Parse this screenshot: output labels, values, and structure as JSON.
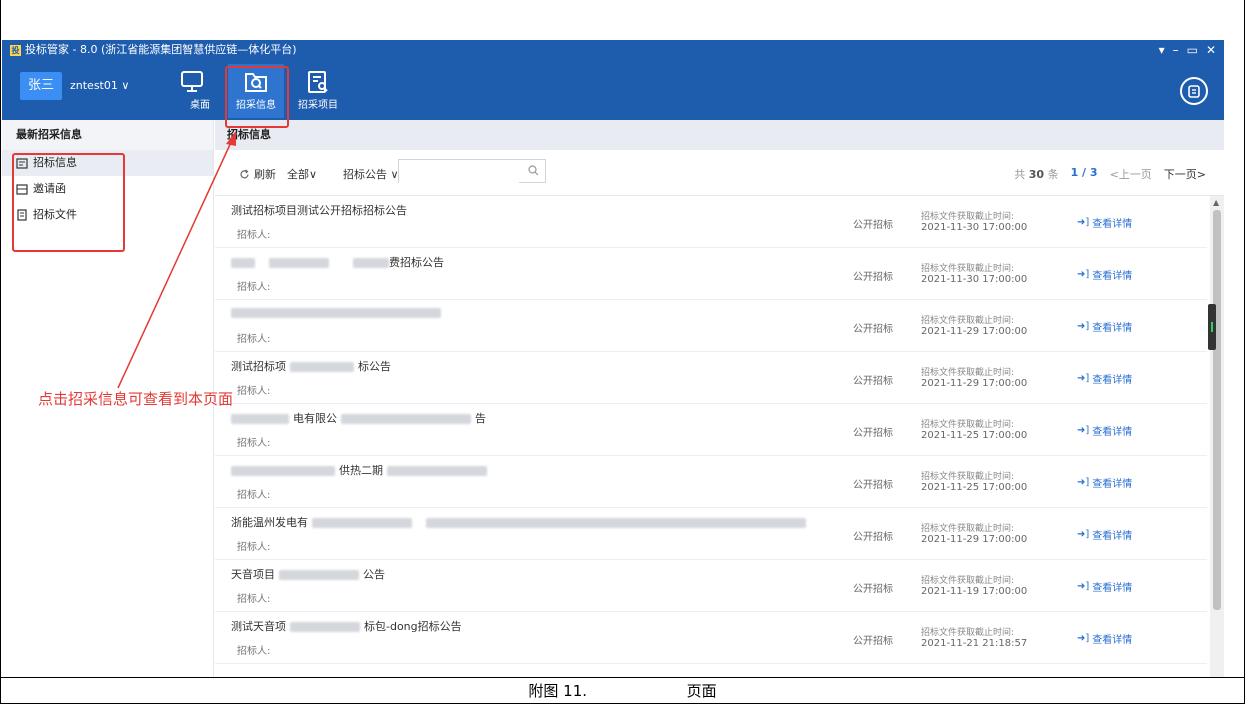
{
  "window": {
    "title": "投标管家 - 8.0 (浙江省能源集团智慧供应链—体化平台)",
    "controls": [
      "▾",
      "–",
      "▭",
      "✕"
    ]
  },
  "toolbar": {
    "user_badge": "张三",
    "user_name": "zntest01 ∨",
    "desktop_label": "桌面",
    "info_label": "招采信息",
    "project_label": "招采项目"
  },
  "sidebar": {
    "title": "最新招采信息",
    "items": [
      {
        "label": "招标信息",
        "icon": "notice-icon"
      },
      {
        "label": "邀请函",
        "icon": "mail-icon"
      },
      {
        "label": "招标文件",
        "icon": "file-icon"
      }
    ]
  },
  "main": {
    "header": "招标信息",
    "refresh_label": "刷新",
    "filter_all": "全部∨",
    "filter_type": "招标公告 ∨",
    "search_placeholder": "",
    "pager": {
      "total_prefix": "共",
      "total": "30",
      "total_suffix": "条",
      "page": "1 / 3",
      "prev": "<上一页",
      "next": "下一页>"
    },
    "rows": [
      {
        "title": "测试招标项目测试公开招标招标公告",
        "owner": "招标人:",
        "mode": "公开招标",
        "deadline_label": "招标文件获取截止时间:",
        "deadline": "2021-11-30 17:00:00",
        "detail": "查看详情"
      },
      {
        "title": "费招标公告",
        "owner": "招标人:",
        "mode": "公开招标",
        "deadline_label": "招标文件获取截止时间:",
        "deadline": "2021-11-30 17:00:00",
        "detail": "查看详情"
      },
      {
        "title": "",
        "owner": "招标人:",
        "mode": "公开招标",
        "deadline_label": "招标文件获取截止时间:",
        "deadline": "2021-11-29 17:00:00",
        "detail": "查看详情"
      },
      {
        "title": "测试招标项",
        "title_tail": "标公告",
        "owner": "招标人:",
        "mode": "公开招标",
        "deadline_label": "招标文件获取截止时间:",
        "deadline": "2021-11-29 17:00:00",
        "detail": "查看详情"
      },
      {
        "title": "电有限公",
        "title_tail": "告",
        "owner": "招标人:",
        "mode": "公开招标",
        "deadline_label": "招标文件获取截止时间:",
        "deadline": "2021-11-25 17:00:00",
        "detail": "查看详情"
      },
      {
        "title": "供热二期",
        "owner": "招标人:",
        "mode": "公开招标",
        "deadline_label": "招标文件获取截止时间:",
        "deadline": "2021-11-25 17:00:00",
        "detail": "查看详情"
      },
      {
        "title": "浙能温州发电有",
        "owner": "招标人:",
        "mode": "公开招标",
        "deadline_label": "招标文件获取截止时间:",
        "deadline": "2021-11-29 17:00:00",
        "detail": "查看详情"
      },
      {
        "title": "天音项目",
        "title_tail": "公告",
        "owner": "招标人:",
        "mode": "公开招标",
        "deadline_label": "招标文件获取截止时间:",
        "deadline": "2021-11-19 17:00:00",
        "detail": "查看详情"
      },
      {
        "title": "测试天音项",
        "title_tail": "标包-dong招标公告",
        "owner": "招标人:",
        "mode": "公开招标",
        "deadline_label": "招标文件获取截止时间:",
        "deadline": "2021-11-21 21:18:57",
        "detail": "查看详情"
      }
    ]
  },
  "annotation": {
    "text": "点击招采信息可查看到本页面",
    "color": "#e53935"
  },
  "caption": {
    "figure": "附图 11.",
    "page": "页面"
  },
  "colors": {
    "toolbar": "#1e5cae",
    "accent": "#2a6fd0"
  }
}
